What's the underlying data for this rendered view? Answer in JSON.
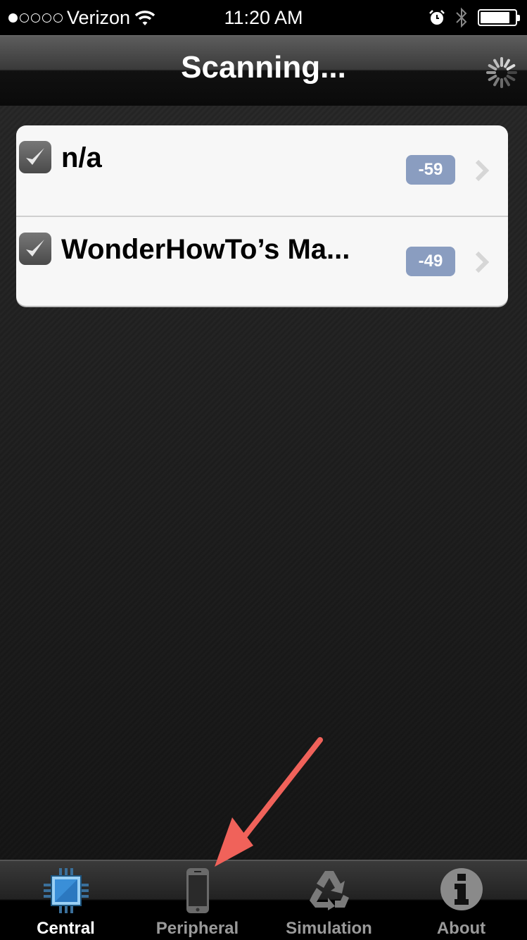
{
  "status_bar": {
    "signal_dots_filled": 1,
    "signal_dots_total": 5,
    "carrier": "Verizon",
    "time": "11:20 AM",
    "battery_level": 0.85
  },
  "nav_bar": {
    "title": "Scanning..."
  },
  "devices": [
    {
      "name": "n/a",
      "rssi": "-59",
      "checked": true
    },
    {
      "name": "WonderHowTo’s Ma...",
      "rssi": "-49",
      "checked": true
    }
  ],
  "tab_bar": {
    "tabs": [
      {
        "label": "Central",
        "icon": "chip-icon",
        "active": true
      },
      {
        "label": "Peripheral",
        "icon": "phone-icon",
        "active": false
      },
      {
        "label": "Simulation",
        "icon": "recycle-icon",
        "active": false
      },
      {
        "label": "About",
        "icon": "info-icon",
        "active": false
      }
    ]
  },
  "colors": {
    "rssi_badge": "#8a9dc0",
    "annotation_arrow": "#f0625a",
    "active_tab_icon": "#3a8fd8"
  }
}
